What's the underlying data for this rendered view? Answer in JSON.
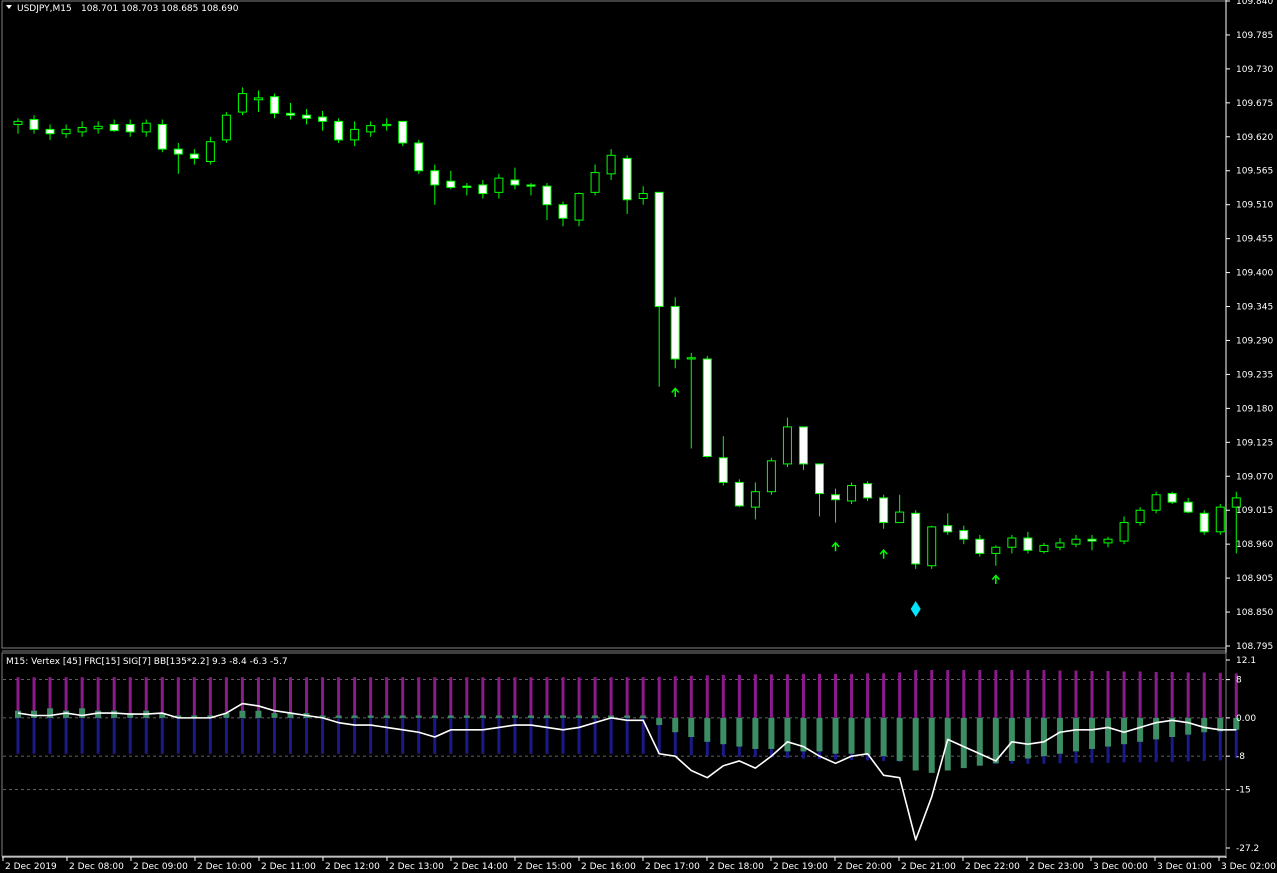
{
  "main_header": {
    "symbol_info": "USDJPY,M15",
    "ohlc": "108.701 108.703 108.685 108.690"
  },
  "indicator_header": {
    "label": "M15: Vertex [45]  FRC[15]  SIG[7]  BB[135*2.2] 9.3 -8.4 -6.3 -5.7"
  },
  "colors": {
    "background": "#000000",
    "candle_outline": "#00ff00",
    "candle_up_fill": "#000000",
    "candle_down_fill": "#ffffff",
    "arrow": "#00ff00",
    "diamond": "#00e5ff",
    "vertex_line": "#ffffff",
    "hist_purple": "#8b1a8b",
    "hist_blue": "#1a1a8b",
    "hist_green": "#3c8c64",
    "level_dash": "#808080",
    "axis": "#ffffff"
  },
  "chart_data": [
    {
      "type": "candlestick",
      "title": "USDJPY,M15",
      "ylim": [
        108.795,
        109.84
      ],
      "yticks": [
        "109.840",
        "109.785",
        "109.730",
        "109.675",
        "109.620",
        "109.565",
        "109.510",
        "109.455",
        "109.400",
        "109.345",
        "109.290",
        "109.235",
        "109.180",
        "109.125",
        "109.070",
        "109.015",
        "108.960",
        "108.905",
        "108.850",
        "108.795"
      ],
      "xticks": [
        "2 Dec 2019",
        "2 Dec 08:00",
        "2 Dec 09:00",
        "2 Dec 10:00",
        "2 Dec 11:00",
        "2 Dec 12:00",
        "2 Dec 13:00",
        "2 Dec 14:00",
        "2 Dec 15:00",
        "2 Dec 16:00",
        "2 Dec 17:00",
        "2 Dec 18:00",
        "2 Dec 19:00",
        "2 Dec 20:00",
        "2 Dec 21:00",
        "2 Dec 22:00",
        "2 Dec 23:00",
        "3 Dec 00:00",
        "3 Dec 01:00",
        "3 Dec 02:00"
      ],
      "candles": [
        {
          "o": 109.64,
          "h": 109.65,
          "l": 109.625,
          "c": 109.645
        },
        {
          "o": 109.648,
          "h": 109.655,
          "l": 109.625,
          "c": 109.632
        },
        {
          "o": 109.632,
          "h": 109.64,
          "l": 109.615,
          "c": 109.625
        },
        {
          "o": 109.625,
          "h": 109.64,
          "l": 109.618,
          "c": 109.632
        },
        {
          "o": 109.628,
          "h": 109.645,
          "l": 109.62,
          "c": 109.635
        },
        {
          "o": 109.633,
          "h": 109.645,
          "l": 109.625,
          "c": 109.637
        },
        {
          "o": 109.64,
          "h": 109.648,
          "l": 109.628,
          "c": 109.63
        },
        {
          "o": 109.64,
          "h": 109.648,
          "l": 109.62,
          "c": 109.628
        },
        {
          "o": 109.628,
          "h": 109.648,
          "l": 109.62,
          "c": 109.642
        },
        {
          "o": 109.64,
          "h": 109.648,
          "l": 109.595,
          "c": 109.6
        },
        {
          "o": 109.6,
          "h": 109.61,
          "l": 109.56,
          "c": 109.592
        },
        {
          "o": 109.592,
          "h": 109.6,
          "l": 109.575,
          "c": 109.585
        },
        {
          "o": 109.58,
          "h": 109.62,
          "l": 109.575,
          "c": 109.612
        },
        {
          "o": 109.615,
          "h": 109.66,
          "l": 109.61,
          "c": 109.655
        },
        {
          "o": 109.66,
          "h": 109.7,
          "l": 109.655,
          "c": 109.69
        },
        {
          "o": 109.68,
          "h": 109.695,
          "l": 109.66,
          "c": 109.683
        },
        {
          "o": 109.685,
          "h": 109.69,
          "l": 109.65,
          "c": 109.658
        },
        {
          "o": 109.658,
          "h": 109.675,
          "l": 109.648,
          "c": 109.655
        },
        {
          "o": 109.655,
          "h": 109.665,
          "l": 109.64,
          "c": 109.65
        },
        {
          "o": 109.652,
          "h": 109.662,
          "l": 109.63,
          "c": 109.645
        },
        {
          "o": 109.645,
          "h": 109.65,
          "l": 109.61,
          "c": 109.615
        },
        {
          "o": 109.615,
          "h": 109.645,
          "l": 109.605,
          "c": 109.632
        },
        {
          "o": 109.628,
          "h": 109.645,
          "l": 109.62,
          "c": 109.638
        },
        {
          "o": 109.638,
          "h": 109.65,
          "l": 109.63,
          "c": 109.64
        },
        {
          "o": 109.645,
          "h": 109.645,
          "l": 109.605,
          "c": 109.61
        },
        {
          "o": 109.61,
          "h": 109.615,
          "l": 109.56,
          "c": 109.565
        },
        {
          "o": 109.565,
          "h": 109.575,
          "l": 109.51,
          "c": 109.542
        },
        {
          "o": 109.548,
          "h": 109.565,
          "l": 109.535,
          "c": 109.538
        },
        {
          "o": 109.54,
          "h": 109.545,
          "l": 109.525,
          "c": 109.538
        },
        {
          "o": 109.542,
          "h": 109.55,
          "l": 109.52,
          "c": 109.528
        },
        {
          "o": 109.53,
          "h": 109.56,
          "l": 109.52,
          "c": 109.553
        },
        {
          "o": 109.55,
          "h": 109.57,
          "l": 109.535,
          "c": 109.542
        },
        {
          "o": 109.542,
          "h": 109.545,
          "l": 109.525,
          "c": 109.54
        },
        {
          "o": 109.54,
          "h": 109.545,
          "l": 109.485,
          "c": 109.51
        },
        {
          "o": 109.51,
          "h": 109.515,
          "l": 109.475,
          "c": 109.488
        },
        {
          "o": 109.485,
          "h": 109.53,
          "l": 109.475,
          "c": 109.528
        },
        {
          "o": 109.53,
          "h": 109.575,
          "l": 109.525,
          "c": 109.562
        },
        {
          "o": 109.56,
          "h": 109.6,
          "l": 109.55,
          "c": 109.59
        },
        {
          "o": 109.585,
          "h": 109.59,
          "l": 109.495,
          "c": 109.518
        },
        {
          "o": 109.52,
          "h": 109.54,
          "l": 109.51,
          "c": 109.528
        },
        {
          "o": 109.53,
          "h": 109.53,
          "l": 109.215,
          "c": 109.345
        },
        {
          "o": 109.345,
          "h": 109.36,
          "l": 109.245,
          "c": 109.26
        },
        {
          "o": 109.26,
          "h": 109.27,
          "l": 109.115,
          "c": 109.262
        },
        {
          "o": 109.26,
          "h": 109.265,
          "l": 109.1,
          "c": 109.102
        },
        {
          "o": 109.1,
          "h": 109.135,
          "l": 109.055,
          "c": 109.06
        },
        {
          "o": 109.06,
          "h": 109.065,
          "l": 109.02,
          "c": 109.022
        },
        {
          "o": 109.02,
          "h": 109.06,
          "l": 109.0,
          "c": 109.045
        },
        {
          "o": 109.045,
          "h": 109.1,
          "l": 109.04,
          "c": 109.095
        },
        {
          "o": 109.09,
          "h": 109.165,
          "l": 109.085,
          "c": 109.15
        },
        {
          "o": 109.15,
          "h": 109.15,
          "l": 109.08,
          "c": 109.09
        },
        {
          "o": 109.09,
          "h": 109.09,
          "l": 109.005,
          "c": 109.042
        },
        {
          "o": 109.04,
          "h": 109.05,
          "l": 108.995,
          "c": 109.032
        },
        {
          "o": 109.03,
          "h": 109.06,
          "l": 109.025,
          "c": 109.055
        },
        {
          "o": 109.058,
          "h": 109.062,
          "l": 109.03,
          "c": 109.035
        },
        {
          "o": 109.035,
          "h": 109.04,
          "l": 108.985,
          "c": 108.995
        },
        {
          "o": 108.995,
          "h": 109.04,
          "l": 108.995,
          "c": 109.012
        },
        {
          "o": 109.01,
          "h": 109.015,
          "l": 108.92,
          "c": 108.928
        },
        {
          "o": 108.925,
          "h": 108.99,
          "l": 108.92,
          "c": 108.988
        },
        {
          "o": 108.99,
          "h": 109.01,
          "l": 108.975,
          "c": 108.98
        },
        {
          "o": 108.982,
          "h": 108.99,
          "l": 108.96,
          "c": 108.968
        },
        {
          "o": 108.968,
          "h": 108.975,
          "l": 108.94,
          "c": 108.945
        },
        {
          "o": 108.945,
          "h": 108.958,
          "l": 108.925,
          "c": 108.955
        },
        {
          "o": 108.955,
          "h": 108.975,
          "l": 108.945,
          "c": 108.97
        },
        {
          "o": 108.97,
          "h": 108.98,
          "l": 108.945,
          "c": 108.95
        },
        {
          "o": 108.948,
          "h": 108.962,
          "l": 108.945,
          "c": 108.958
        },
        {
          "o": 108.955,
          "h": 108.97,
          "l": 108.95,
          "c": 108.962
        },
        {
          "o": 108.96,
          "h": 108.975,
          "l": 108.955,
          "c": 108.968
        },
        {
          "o": 108.968,
          "h": 108.975,
          "l": 108.95,
          "c": 108.965
        },
        {
          "o": 108.962,
          "h": 108.972,
          "l": 108.955,
          "c": 108.968
        },
        {
          "o": 108.965,
          "h": 109.005,
          "l": 108.96,
          "c": 108.995
        },
        {
          "o": 108.995,
          "h": 109.02,
          "l": 108.99,
          "c": 109.015
        },
        {
          "o": 109.015,
          "h": 109.045,
          "l": 109.01,
          "c": 109.04
        },
        {
          "o": 109.042,
          "h": 109.045,
          "l": 109.025,
          "c": 109.028
        },
        {
          "o": 109.028,
          "h": 109.035,
          "l": 109.01,
          "c": 109.012
        },
        {
          "o": 109.01,
          "h": 109.015,
          "l": 108.975,
          "c": 108.98
        },
        {
          "o": 108.98,
          "h": 109.025,
          "l": 108.975,
          "c": 109.02
        },
        {
          "o": 109.02,
          "h": 109.045,
          "l": 108.945,
          "c": 109.035
        }
      ],
      "markers": [
        {
          "type": "up-arrow",
          "index": 41,
          "price": 109.205
        },
        {
          "type": "up-arrow",
          "index": 51,
          "price": 108.955
        },
        {
          "type": "up-arrow",
          "index": 54,
          "price": 108.943
        },
        {
          "type": "up-arrow",
          "index": 61,
          "price": 108.902
        },
        {
          "type": "diamond",
          "index": 56,
          "price": 108.855
        }
      ]
    },
    {
      "type": "indicator",
      "title": "M15: Vertex [45]  FRC[15]  SIG[7]  BB[135*2.2] 9.3 -8.4 -6.3 -5.7",
      "ylim": [
        -27.2,
        12.1
      ],
      "yticks": [
        "12.1",
        "8",
        "0.00",
        "-8",
        "-15",
        "-27.2"
      ],
      "levels": [
        8,
        0,
        -8,
        -15
      ],
      "bb_upper": [
        8.5,
        8.5,
        8.5,
        8.5,
        8.5,
        8.5,
        8.5,
        8.5,
        8.5,
        8.5,
        8.5,
        8.5,
        8.5,
        8.5,
        8.5,
        8.5,
        8.5,
        8.5,
        8.5,
        8.5,
        8.5,
        8.5,
        8.5,
        8.5,
        8.5,
        8.5,
        8.5,
        8.5,
        8.5,
        8.5,
        8.5,
        8.5,
        8.5,
        8.5,
        8.5,
        8.5,
        8.5,
        8.5,
        8.5,
        8.5,
        8.6,
        8.7,
        8.8,
        8.9,
        9.0,
        9.0,
        9.1,
        9.1,
        9.1,
        9.2,
        9.2,
        9.2,
        9.2,
        9.3,
        9.3,
        9.5,
        10.0,
        10.0,
        10.0,
        10.0,
        10.0,
        10.0,
        10.0,
        10.0,
        10.0,
        9.9,
        9.9,
        9.8,
        9.8,
        9.7,
        9.7,
        9.6,
        9.6,
        9.5,
        9.5,
        9.4,
        9.3
      ],
      "bb_lower": [
        -7.5,
        -7.5,
        -7.5,
        -7.5,
        -7.5,
        -7.5,
        -7.5,
        -7.5,
        -7.5,
        -7.5,
        -7.5,
        -7.5,
        -7.5,
        -7.5,
        -7.5,
        -7.5,
        -7.5,
        -7.5,
        -7.5,
        -7.5,
        -7.5,
        -7.5,
        -7.5,
        -7.5,
        -7.5,
        -7.5,
        -7.5,
        -7.5,
        -7.5,
        -7.5,
        -7.5,
        -7.5,
        -7.5,
        -7.5,
        -7.5,
        -7.5,
        -7.5,
        -7.5,
        -7.5,
        -7.5,
        -7.6,
        -7.7,
        -7.8,
        -7.9,
        -8.0,
        -8.1,
        -8.2,
        -8.3,
        -8.4,
        -8.5,
        -8.6,
        -8.7,
        -8.8,
        -8.9,
        -9.0,
        -9.2,
        -9.6,
        -9.7,
        -9.7,
        -9.7,
        -9.7,
        -9.7,
        -9.6,
        -9.6,
        -9.6,
        -9.5,
        -9.5,
        -9.4,
        -9.4,
        -9.3,
        -9.3,
        -9.2,
        -9.2,
        -9.1,
        -9.0,
        -8.9,
        -8.4
      ],
      "green": [
        1.5,
        1.5,
        2.0,
        1.5,
        2.0,
        1.5,
        1.5,
        1.0,
        1.5,
        1.0,
        0.5,
        0.5,
        0.5,
        1.0,
        1.5,
        1.5,
        1.0,
        1.0,
        1.0,
        0.5,
        0.5,
        0.5,
        0.5,
        0.5,
        0.5,
        0.5,
        0.5,
        0.5,
        0.5,
        0.5,
        0.5,
        0.5,
        0.5,
        0.5,
        0.5,
        0.5,
        0.5,
        0.5,
        0.5,
        0.5,
        -1.5,
        -3.0,
        -4.0,
        -5.0,
        -5.5,
        -6.0,
        -6.5,
        -6.5,
        -7.0,
        -7.0,
        -7.0,
        -7.5,
        -7.5,
        -7.8,
        -8.0,
        -9.0,
        -11.0,
        -11.5,
        -11.0,
        -10.5,
        -10.0,
        -9.5,
        -9.0,
        -8.5,
        -8.0,
        -7.5,
        -7.0,
        -6.5,
        -6.0,
        -5.5,
        -5.0,
        -4.5,
        -4.0,
        -3.5,
        -3.0,
        -2.8,
        -2.5
      ],
      "vertex": [
        1.0,
        0.5,
        0.5,
        1.0,
        0.5,
        1.0,
        1.0,
        0.8,
        0.8,
        1.0,
        0.0,
        0.0,
        0.0,
        1.0,
        3.0,
        2.5,
        1.5,
        1.0,
        0.5,
        0.0,
        -1.0,
        -1.5,
        -1.5,
        -2.0,
        -2.5,
        -3.0,
        -4.0,
        -2.5,
        -2.5,
        -2.5,
        -2.0,
        -1.5,
        -1.5,
        -2.0,
        -2.5,
        -2.0,
        -1.0,
        0.0,
        -0.5,
        -0.5,
        -7.5,
        -8.0,
        -11.0,
        -12.5,
        -10.0,
        -9.0,
        -10.5,
        -8.0,
        -5.0,
        -6.0,
        -8.0,
        -9.5,
        -8.0,
        -7.5,
        -12.0,
        -12.5,
        -25.5,
        -16.5,
        -4.5,
        -6.0,
        -7.5,
        -9.0,
        -5.0,
        -5.5,
        -5.0,
        -3.0,
        -2.5,
        -2.5,
        -2.0,
        -3.0,
        -2.0,
        -1.0,
        -0.5,
        -1.0,
        -2.0,
        -2.5,
        -2.5
      ]
    }
  ]
}
